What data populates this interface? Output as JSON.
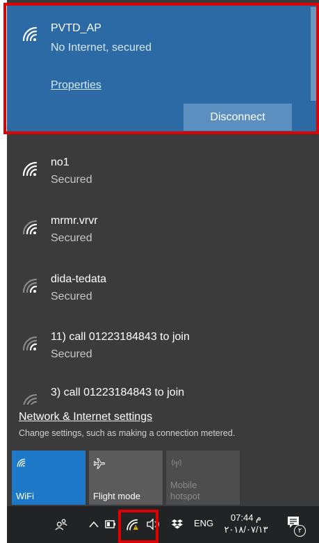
{
  "connected_network": {
    "name": "PVTD_AP",
    "status": "No Internet, secured",
    "properties_label": "Properties",
    "disconnect_label": "Disconnect"
  },
  "networks": [
    {
      "name": "no1",
      "status": "Secured"
    },
    {
      "name": "mrmr.vrvr",
      "status": "Secured"
    },
    {
      "name": " dida-tedata",
      "status": "Secured"
    },
    {
      "name": "11) call 01223184843 to join",
      "status": "Secured"
    },
    {
      "name": "3) call 01223184843 to join",
      "status": ""
    }
  ],
  "settings": {
    "link": "Network & Internet settings",
    "description": "Change settings, such as making a connection metered."
  },
  "quick_actions": [
    {
      "label": "WiFi",
      "icon": "wifi-icon",
      "state": "on"
    },
    {
      "label": "Flight mode",
      "icon": "airplane-icon",
      "state": "off"
    },
    {
      "label_line1": "Mobile",
      "label_line2": "hotspot",
      "icon": "hotspot-icon",
      "state": "disabled"
    }
  ],
  "taskbar": {
    "language": "ENG",
    "time": "07:44 م",
    "date": "٢٠١٨/٠٧/١٣",
    "notification_badge": "٢"
  },
  "colors": {
    "panel_bg": "#3b3b3b",
    "connected_bg": "#2c6aa5",
    "accent_tile": "#1e78c8",
    "highlight_frame": "#e00000",
    "taskbar_bg": "#222324"
  }
}
